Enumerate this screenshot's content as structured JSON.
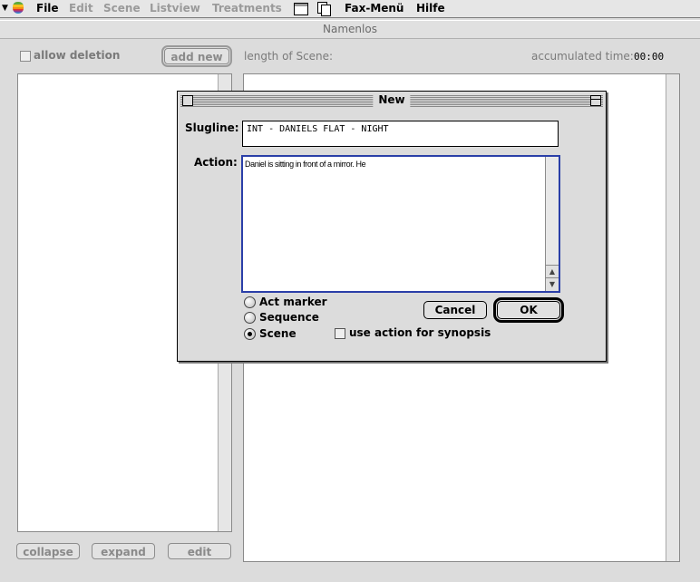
{
  "menubar": {
    "items": [
      {
        "label": "File",
        "dim": false
      },
      {
        "label": "Edit",
        "dim": true
      },
      {
        "label": "Scene",
        "dim": true
      },
      {
        "label": "Listview",
        "dim": true
      },
      {
        "label": "Treatments",
        "dim": true
      },
      {
        "label": "Fax-Menü",
        "dim": false
      },
      {
        "label": "Hilfe",
        "dim": false
      }
    ]
  },
  "window": {
    "title": "Namenlos",
    "allow_deletion": "allow deletion",
    "add_new": "add new",
    "length_of_scene": "length of Scene:",
    "accumulated_time_label": "accumulated time:",
    "accumulated_time_value": "00:00",
    "collapse": "collapse",
    "expand": "expand",
    "edit": "edit"
  },
  "dialog": {
    "title": "New",
    "slugline_label": "Slugline:",
    "slugline_value": "INT - DANIELS FLAT - NIGHT",
    "action_label": "Action:",
    "action_value": "Daniel is sitting in front of a mirror. He",
    "radios": [
      {
        "label": "Act marker",
        "selected": false
      },
      {
        "label": "Sequence",
        "selected": false
      },
      {
        "label": "Scene",
        "selected": true
      }
    ],
    "cancel": "Cancel",
    "ok": "OK",
    "use_action": "use action for synopsis"
  }
}
